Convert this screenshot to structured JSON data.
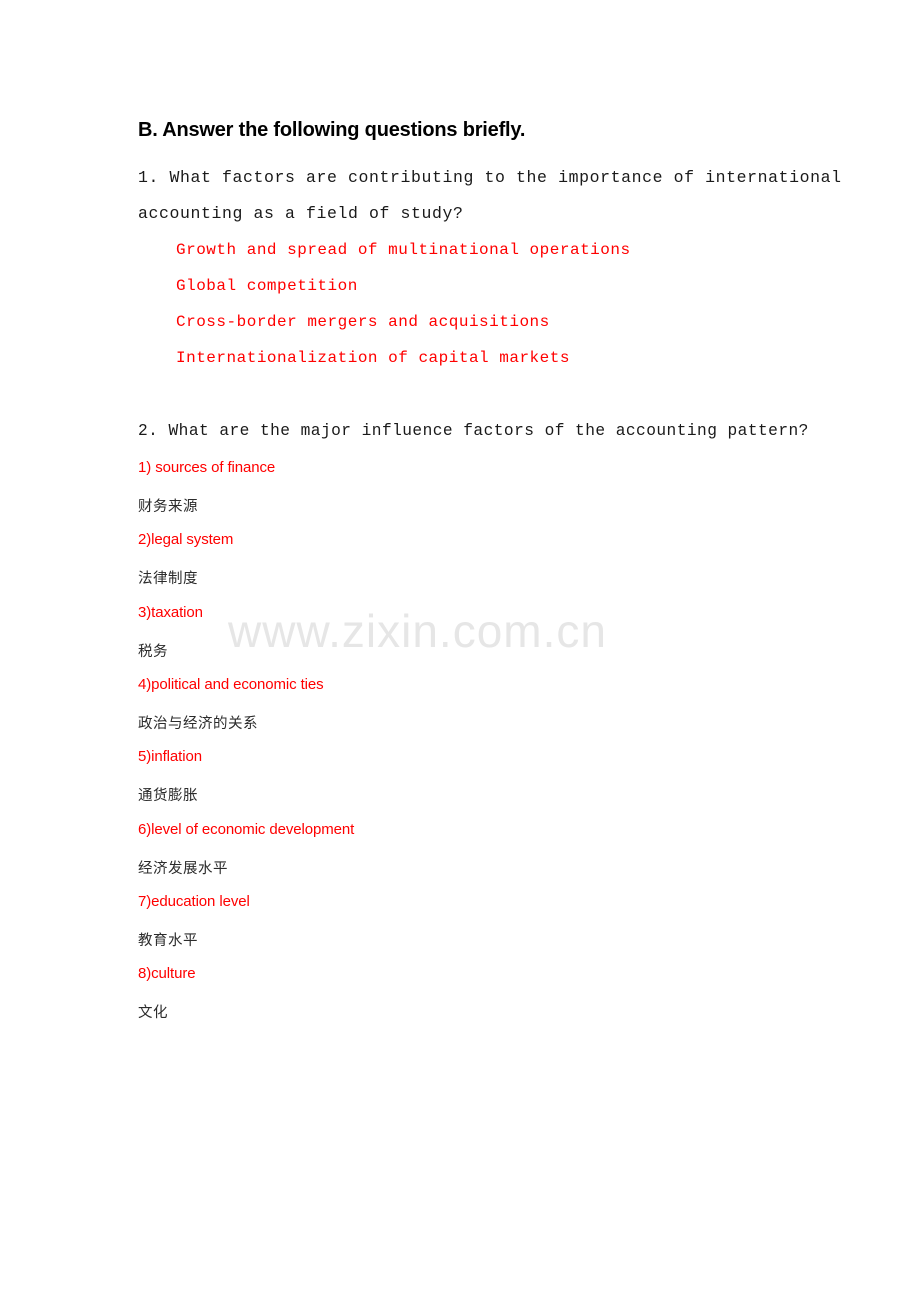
{
  "document": {
    "section_heading": "B. Answer the following questions briefly.",
    "watermark": "www.zixin.com.cn",
    "colors": {
      "answer_red": "#FF0000",
      "body_text": "#1A1A1A",
      "watermark_gray": "#E6E6E6",
      "page_background": "#FFFFFF"
    }
  },
  "questions": [
    {
      "number": "1.",
      "text_line_1": "1. What factors are contributing to the importance of international",
      "text_line_2": "accounting as a field of study?",
      "answers": [
        "Growth and spread of multinational operations",
        "Global competition",
        "Cross-border mergers and acquisitions",
        "Internationalization of capital markets"
      ]
    },
    {
      "number": "2.",
      "text_line_1": "2. What are the major influence factors of the accounting pattern?",
      "answer_items": [
        {
          "en": "1) sources of finance",
          "zh": "财务来源"
        },
        {
          "en": "2)legal system",
          "zh": "法律制度"
        },
        {
          "en": "3)taxation",
          "zh": "税务"
        },
        {
          "en": "4)political and economic ties",
          "zh": "政治与经济的关系"
        },
        {
          "en": "5)inflation",
          "zh": "通货膨胀"
        },
        {
          "en": "6)level of economic development",
          "zh": "经济发展水平"
        },
        {
          "en": "7)education level",
          "zh": "教育水平"
        },
        {
          "en": "8)culture",
          "zh": "文化"
        }
      ]
    }
  ]
}
